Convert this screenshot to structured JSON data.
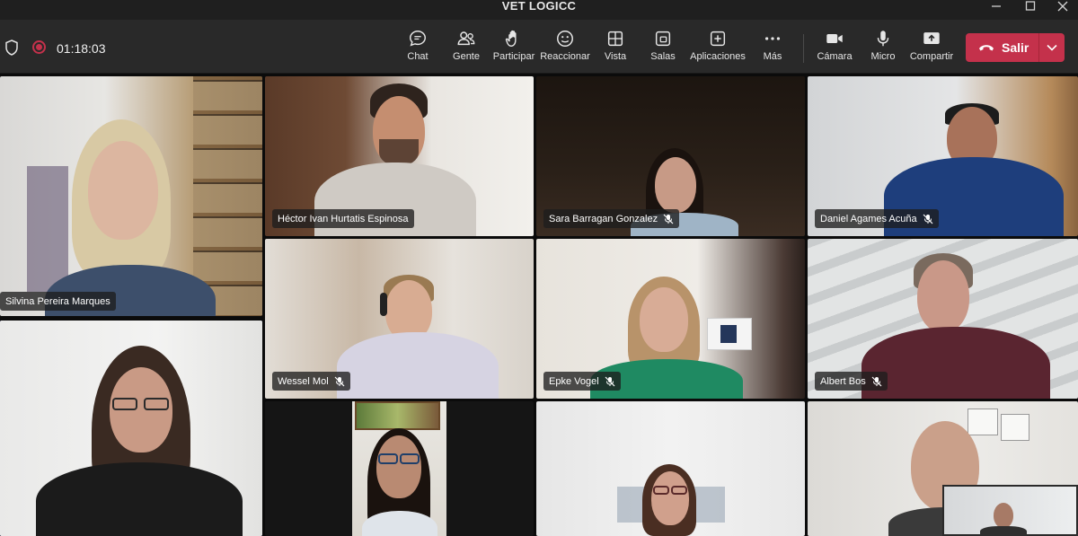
{
  "window": {
    "title": "VET LOGICC"
  },
  "meeting": {
    "timer": "01:18:03"
  },
  "toolbar": {
    "buttons": [
      {
        "id": "chat",
        "label": "Chat",
        "icon": "chat-icon"
      },
      {
        "id": "people",
        "label": "Gente",
        "icon": "people-icon"
      },
      {
        "id": "raise",
        "label": "Participar",
        "icon": "raise-hand-icon"
      },
      {
        "id": "react",
        "label": "Reaccionar",
        "icon": "smiley-icon"
      },
      {
        "id": "view",
        "label": "Vista",
        "icon": "grid-view-icon"
      },
      {
        "id": "rooms",
        "label": "Salas",
        "icon": "breakout-rooms-icon"
      },
      {
        "id": "apps",
        "label": "Aplicaciones",
        "icon": "add-apps-icon"
      },
      {
        "id": "more",
        "label": "Más",
        "icon": "more-icon"
      },
      {
        "id": "camera",
        "label": "Cámara",
        "icon": "camera-icon"
      },
      {
        "id": "mic",
        "label": "Micro",
        "icon": "microphone-icon"
      },
      {
        "id": "share",
        "label": "Compartir",
        "icon": "share-screen-icon"
      }
    ],
    "leave_label": "Salir",
    "leave_color": "#c4314b"
  },
  "participants": [
    {
      "name": "Silvina Pereira Marques",
      "muted": false
    },
    {
      "name": "Héctor Ivan Hurtatis Espinosa",
      "muted": false
    },
    {
      "name": "Sara Barragan Gonzalez",
      "muted": true
    },
    {
      "name": "Daniel Agames Acuña",
      "muted": true
    },
    {
      "name": "Wessel Mol",
      "muted": true
    },
    {
      "name": "Epke Vogel",
      "muted": true
    },
    {
      "name": "Albert Bos",
      "muted": true
    }
  ],
  "colors": {
    "accent": "#8c8fd6",
    "toolbar_bg": "#292929"
  }
}
